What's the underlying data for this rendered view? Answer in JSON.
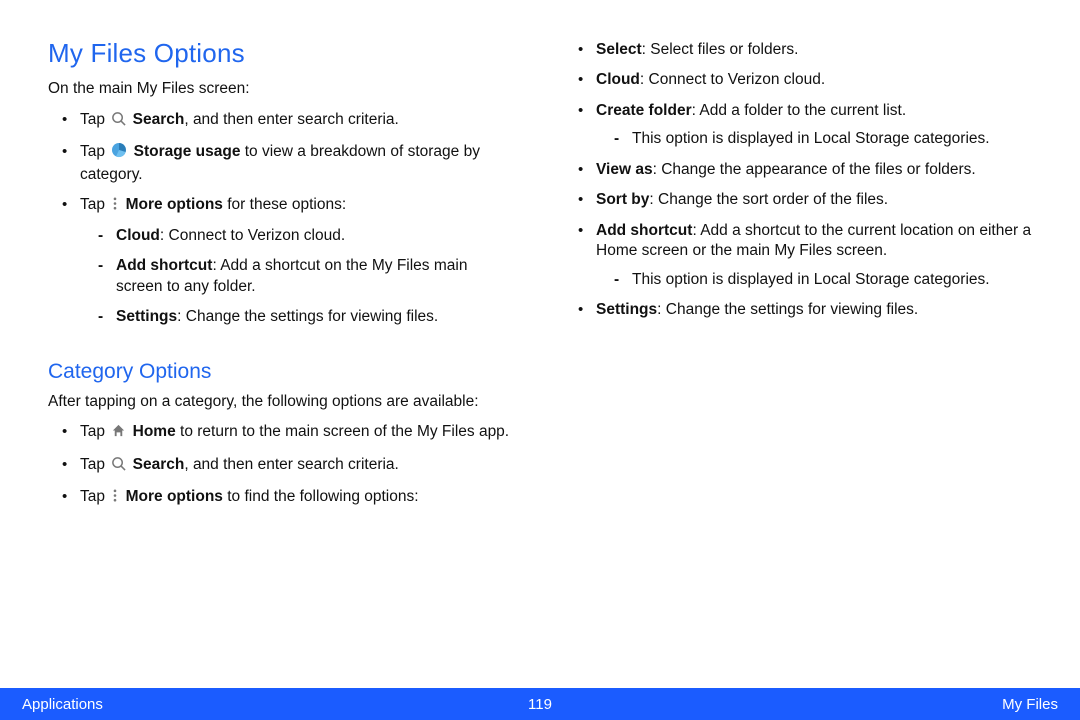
{
  "left": {
    "heading": "My Files Options",
    "intro": "On the main My Files screen:",
    "b1_prefix": "Tap ",
    "b1_bold": "Search",
    "b1_rest": ", and then enter search criteria.",
    "b2_prefix": "Tap ",
    "b2_bold": "Storage usage",
    "b2_rest": " to view a breakdown of storage by category.",
    "b3_prefix": "Tap ",
    "b3_bold": "More options",
    "b3_rest": " for these options:",
    "b3a_bold": "Cloud",
    "b3a_rest": ": Connect to Verizon cloud.",
    "b3b_bold": "Add shortcut",
    "b3b_rest": ": Add a shortcut on the My Files main screen to any folder.",
    "b3c_bold": "Settings",
    "b3c_rest": ": Change the settings for viewing files.",
    "sub_heading": "Category Options",
    "sub_intro": "After tapping on a category, the following options are available:",
    "c1_prefix": "Tap ",
    "c1_bold": "Home",
    "c1_rest": " to return to the main screen of the My Files app.",
    "c2_prefix": "Tap ",
    "c2_bold": "Search",
    "c2_rest": ", and then enter search criteria.",
    "c3_prefix": "Tap ",
    "c3_bold": "More options",
    "c3_rest": " to find the following options:"
  },
  "right": {
    "r1_bold": "Select",
    "r1_rest": ": Select files or folders.",
    "r2_bold": "Cloud",
    "r2_rest": ": Connect to Verizon cloud.",
    "r3_bold": "Create folder",
    "r3_rest": ": Add a folder to the current list.",
    "r3a": "This option is displayed in Local Storage categories.",
    "r4_bold": "View as",
    "r4_rest": ": Change the appearance of the files or folders.",
    "r5_bold": "Sort by",
    "r5_rest": ": Change the sort order of the files.",
    "r6_bold": "Add shortcut",
    "r6_rest": ": Add a shortcut to the current location on either a Home screen or the main My Files screen.",
    "r6a": "This option is displayed in Local Storage categories.",
    "r7_bold": "Settings",
    "r7_rest": ": Change the settings for viewing files."
  },
  "footer": {
    "left": "Applications",
    "page": "119",
    "right": "My Files"
  }
}
